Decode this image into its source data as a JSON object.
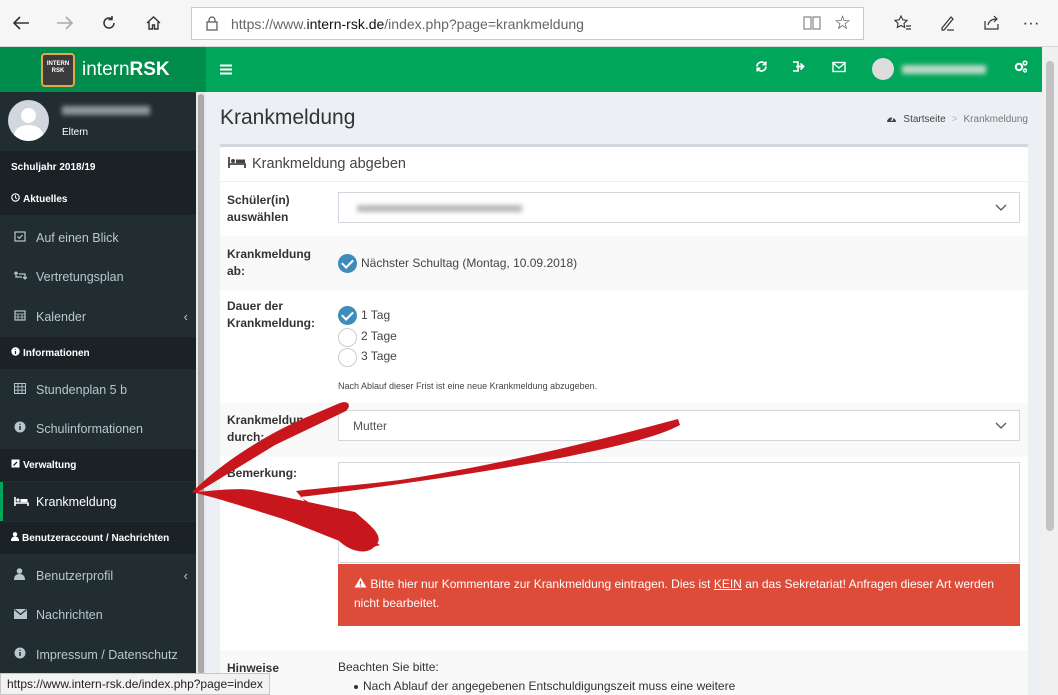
{
  "browser": {
    "url_prefix": "https://www.",
    "url_domain": "intern-rsk.de",
    "url_path": "/index.php?page=krankmeldung",
    "status_url": "https://www.intern-rsk.de/index.php?page=index"
  },
  "app": {
    "logo_badge_line1": "INTERN",
    "logo_badge_line2": "RSK",
    "logo_text_light": "intern",
    "logo_text_bold": "RSK"
  },
  "user": {
    "role": "Eltern"
  },
  "sidebar": {
    "school_year": "Schuljahr 2018/19",
    "sections": {
      "aktuelles": "Aktuelles",
      "informationen": "Informationen",
      "verwaltung": "Verwaltung",
      "benutzeraccount": "Benutzeraccount / Nachrichten"
    },
    "items": {
      "auf_einen_blick": "Auf einen Blick",
      "vertretungsplan": "Vertretungsplan",
      "kalender": "Kalender",
      "stundenplan": "Stundenplan 5 b",
      "schulinformationen": "Schulinformationen",
      "krankmeldung": "Krankmeldung",
      "benutzerprofil": "Benutzerprofil",
      "nachrichten": "Nachrichten",
      "impressum": "Impressum / Datenschutz"
    }
  },
  "page": {
    "title": "Krankmeldung",
    "breadcrumb_home": "Startseite",
    "breadcrumb_current": "Krankmeldung"
  },
  "form": {
    "box_title": "Krankmeldung abgeben",
    "schueler_label_1": "Schüler(in)",
    "schueler_label_2": "auswählen",
    "ab_label_1": "Krankmeldung",
    "ab_label_2": "ab:",
    "ab_option": "Nächster Schultag (Montag, 10.09.2018)",
    "dauer_label_1": "Dauer der",
    "dauer_label_2": "Krankmeldung:",
    "dauer_options": [
      "1 Tag",
      "2 Tage",
      "3 Tage"
    ],
    "dauer_hint": "Nach Ablauf dieser Frist ist eine neue Krankmeldung abzugeben.",
    "durch_label_1": "Krankmeldung",
    "durch_label_2": "durch:",
    "durch_value": "Mutter",
    "bemerkung_label": "Bemerkung:",
    "alert_part1": "Bitte hier nur Kommentare zur Krankmeldung eintragen. Dies ist ",
    "alert_kein": "KEIN",
    "alert_part2": " an das Sekretariat! Anfragen dieser Art werden",
    "alert_line2": "nicht bearbeitet.",
    "hinweise_label": "Hinweise",
    "hinweise_intro": "Beachten Sie bitte:",
    "hinweise_item1": "Nach Ablauf der angegebenen Entschuldigungszeit muss eine weitere"
  },
  "colors": {
    "topbar": "#00a65a",
    "logo_bar": "#008d4c",
    "sidebar": "#222d32",
    "check": "#3c8dbc",
    "alert": "#dd4b39",
    "annotation_arrow": "#c8161d"
  }
}
